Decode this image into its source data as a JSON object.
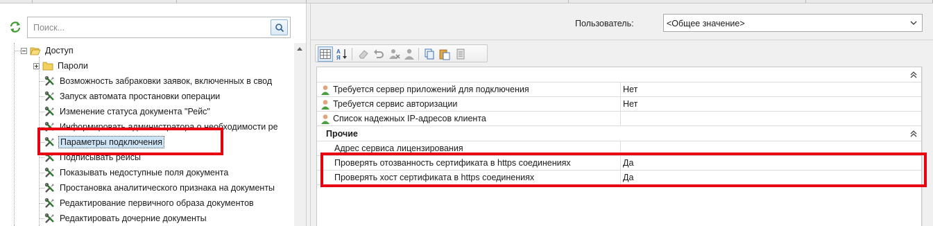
{
  "left": {
    "search_placeholder": "Поиск...",
    "tree": {
      "root_label": "Доступ",
      "items": [
        "Пароли",
        "Возможность забраковки заявок, включенных в свод",
        "Запуск автомата простановки операции",
        "Изменение статуса документа \"Рейс\"",
        "Информировать администратора о необходимости ре",
        "Параметры подключения",
        "Подписывать рейсы",
        "Показывать недоступные поля документа",
        "Простановка аналитического признака на документы",
        "Редактирование первичного образа документов",
        "Редактировать дочерние документы"
      ]
    }
  },
  "right": {
    "user_label": "Пользователь:",
    "user_value": "<Общее значение>",
    "properties": [
      {
        "name": "Требуется сервер приложений для подключения",
        "value": "Нет"
      },
      {
        "name": "Требуется сервис авторизации",
        "value": "Нет"
      },
      {
        "name": "Список надежных IP-адресов клиента",
        "value": ""
      }
    ],
    "group_other": {
      "title": "Прочие",
      "properties": [
        {
          "name": "Адрес сервиса лицензирования",
          "value": ""
        },
        {
          "name": "Проверять отозванность сертификата в https соединениях",
          "value": "Да"
        },
        {
          "name": "Проверять хост сертификата в https соединениях",
          "value": "Да"
        }
      ]
    }
  },
  "colors": {
    "highlight_red": "#e60012",
    "selection_blue": "#cde3f6"
  }
}
